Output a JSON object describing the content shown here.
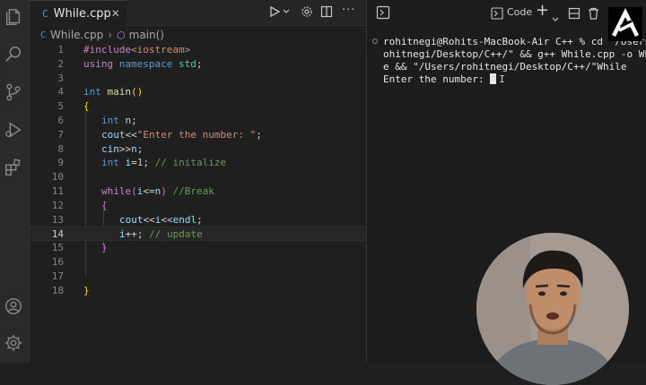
{
  "editor": {
    "tab": {
      "icon": "C",
      "name": "While.cpp",
      "close": "✕"
    },
    "breadcrumb": {
      "file": "While.cpp",
      "symbol": "main()"
    }
  },
  "code_lines": [
    {
      "n": "1"
    },
    {
      "n": "2"
    },
    {
      "n": "3"
    },
    {
      "n": "4"
    },
    {
      "n": "5"
    },
    {
      "n": "6"
    },
    {
      "n": "7"
    },
    {
      "n": "8"
    },
    {
      "n": "9"
    },
    {
      "n": "10"
    },
    {
      "n": "11"
    },
    {
      "n": "12"
    },
    {
      "n": "13"
    },
    {
      "n": "14"
    },
    {
      "n": "15"
    },
    {
      "n": "16"
    },
    {
      "n": "17"
    },
    {
      "n": "18"
    }
  ],
  "code": {
    "l1_inc": "#include",
    "l1_hdr": "<iostream>",
    "l2_kw1": "using",
    "l2_kw2": "namespace",
    "l2_ns": "std",
    "l2_semi": ";",
    "l4_kw": "int",
    "l4_fn": "main",
    "l4_paren": "()",
    "l5": "{",
    "l6_kw": "int",
    "l6_var": "n",
    "l6_semi": ";",
    "l7_var": "cout",
    "l7_op": "<<",
    "l7_str": "\"Enter the number: \"",
    "l7_semi": ";",
    "l8_var1": "cin",
    "l8_op": ">>",
    "l8_var2": "n",
    "l8_semi": ";",
    "l9_kw": "int",
    "l9_var": "i",
    "l9_eq": "=",
    "l9_num": "1",
    "l9_semi": "; ",
    "l9_cm": "// initalize",
    "l11_kw": "while",
    "l11_open": "(",
    "l11_v1": "i",
    "l11_op": "<=",
    "l11_v2": "n",
    "l11_close": ")",
    "l11_cm": " //Break",
    "l12": "{",
    "l13_v1": "cout",
    "l13_op1": "<<",
    "l13_v2": "i",
    "l13_op2": "<<",
    "l13_v3": "endl",
    "l13_semi": ";",
    "l14_var": "i",
    "l14_op": "++",
    "l14_semi": "; ",
    "l14_cm": "// update",
    "l15": "}",
    "l18": "}"
  },
  "terminal": {
    "label": "Code",
    "plus": "+",
    "line1": "rohitnegi@Rohits-MacBook-Air C++ % cd \"/Users/r",
    "line2": "ohitnegi/Desktop/C++/\" && g++ While.cpp -o Whil",
    "line3": "e && \"/Users/rohitnegi/Desktop/C++/\"While",
    "line4": "Enter the number: "
  },
  "colors": {
    "accent": "#519aba",
    "keyword": "#569cd6",
    "string": "#ce9178",
    "comment": "#6a9955"
  },
  "icons": [
    "files-icon",
    "search-icon",
    "source-control-icon",
    "run-debug-icon",
    "extensions-icon",
    "account-icon",
    "settings-gear-icon"
  ]
}
